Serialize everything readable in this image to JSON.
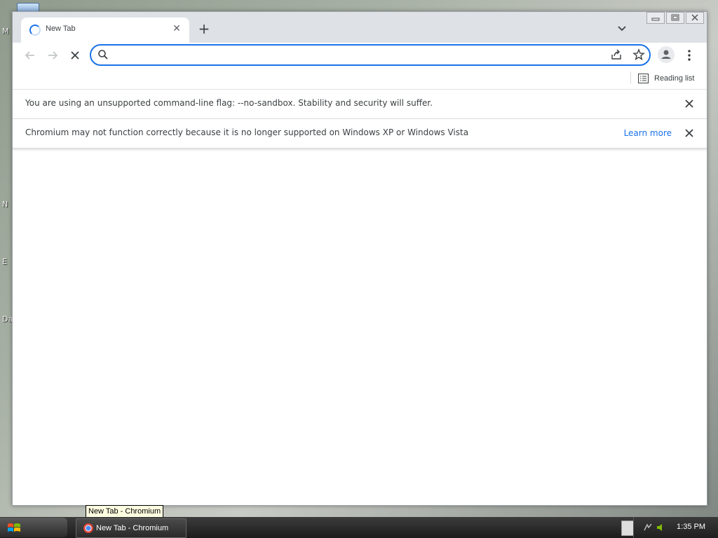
{
  "desktop": {
    "labels": [
      "M",
      "N",
      "E",
      "Da"
    ]
  },
  "tab": {
    "title": "New Tab",
    "close_label": "✕"
  },
  "new_tab_label": "+",
  "omnibox": {
    "value": "",
    "placeholder": ""
  },
  "reading_list_label": "Reading list",
  "infobars": [
    {
      "message": "You are using an unsupported command-line flag: --no-sandbox. Stability and security will suffer."
    },
    {
      "message": "Chromium may not function correctly because it is no longer supported on Windows XP or Windows Vista",
      "link": "Learn more"
    }
  ],
  "tooltip": "New Tab - Chromium",
  "taskbar": {
    "item_label": "New Tab - Chromium",
    "clock": "1:35 PM"
  },
  "colors": {
    "accent": "#1a73e8",
    "titlebar": "#dee1e6"
  }
}
